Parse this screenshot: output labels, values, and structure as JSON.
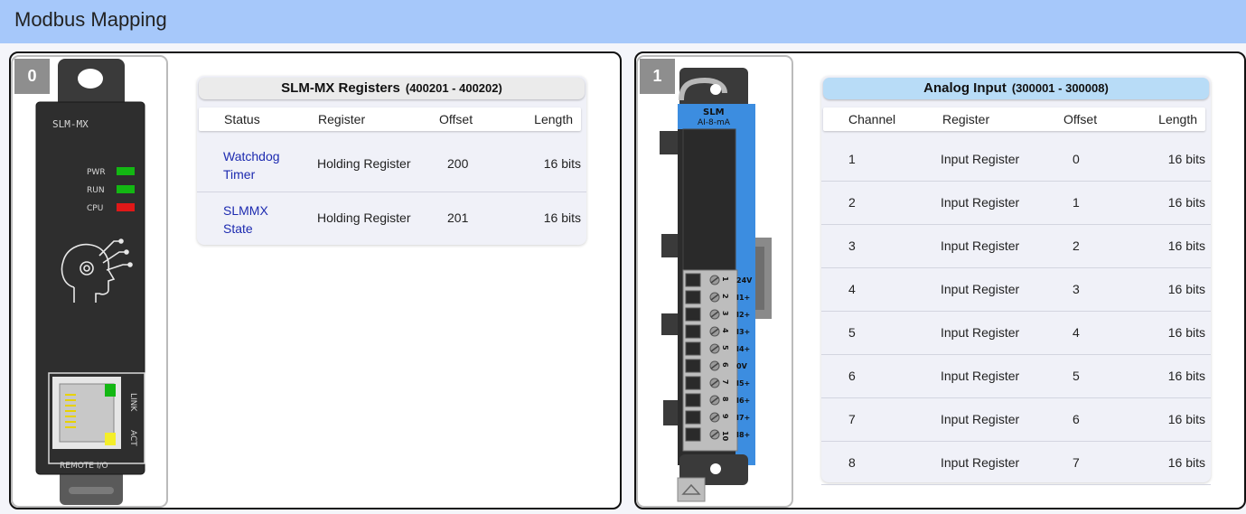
{
  "header": {
    "title": "Modbus Mapping"
  },
  "slots": [
    {
      "number": "0",
      "device": {
        "name": "SLM-MX",
        "leds": [
          {
            "label": "PWR",
            "color": "#13b713"
          },
          {
            "label": "RUN",
            "color": "#13b713"
          },
          {
            "label": "CPU",
            "color": "#e01818"
          }
        ],
        "port_labels": {
          "link": "LINK",
          "act": "ACT"
        },
        "footer": "REMOTE I/O"
      },
      "table": {
        "title": "SLM-MX Registers",
        "range": "(400201 - 400202)",
        "header_color": "#ebebeb",
        "columns": [
          "Status",
          "Register",
          "Offset",
          "Length"
        ],
        "rows": [
          {
            "status": [
              "Watchdog",
              "Timer"
            ],
            "register": "Holding Register",
            "offset": "200",
            "length": "16 bits"
          },
          {
            "status": [
              "SLMMX",
              "State"
            ],
            "register": "Holding Register",
            "offset": "201",
            "length": "16 bits"
          }
        ]
      }
    },
    {
      "number": "1",
      "device": {
        "brand": "SLM",
        "model": "AI-8-mA",
        "terminal_numbers": [
          "1",
          "2",
          "3",
          "4",
          "5",
          "6",
          "7",
          "8",
          "9",
          "10"
        ],
        "terminal_labels": [
          "24V",
          "I1+",
          "I2+",
          "I3+",
          "I4+",
          "0V",
          "I5+",
          "I6+",
          "I7+",
          "I8+"
        ]
      },
      "table": {
        "title": "Analog Input",
        "range": "(300001 - 300008)",
        "header_color": "#b8dcf7",
        "columns": [
          "Channel",
          "Register",
          "Offset",
          "Length"
        ],
        "rows": [
          {
            "channel": "1",
            "register": "Input Register",
            "offset": "0",
            "length": "16 bits"
          },
          {
            "channel": "2",
            "register": "Input Register",
            "offset": "1",
            "length": "16 bits"
          },
          {
            "channel": "3",
            "register": "Input Register",
            "offset": "2",
            "length": "16 bits"
          },
          {
            "channel": "4",
            "register": "Input Register",
            "offset": "3",
            "length": "16 bits"
          },
          {
            "channel": "5",
            "register": "Input Register",
            "offset": "4",
            "length": "16 bits"
          },
          {
            "channel": "6",
            "register": "Input Register",
            "offset": "5",
            "length": "16 bits"
          },
          {
            "channel": "7",
            "register": "Input Register",
            "offset": "6",
            "length": "16 bits"
          },
          {
            "channel": "8",
            "register": "Input Register",
            "offset": "7",
            "length": "16 bits"
          }
        ]
      }
    }
  ]
}
